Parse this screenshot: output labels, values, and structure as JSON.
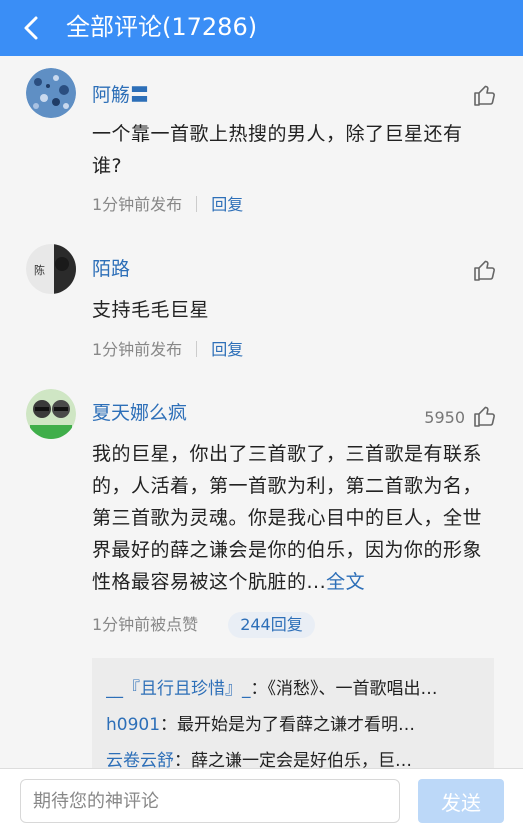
{
  "header": {
    "title": "全部评论(17286)",
    "back_icon": "chevron-left-icon",
    "background": "#3a8ef6"
  },
  "comments": [
    {
      "username": "阿觞〓",
      "text": "一个靠一首歌上热搜的男人，除了巨星还有谁?",
      "time": "1分钟前发布",
      "reply_label": "回复",
      "like_count": ""
    },
    {
      "username": "陌路",
      "text": "支持毛毛巨星",
      "time": "1分钟前发布",
      "reply_label": "回复",
      "like_count": ""
    },
    {
      "username": "夏天娜么疯",
      "text": "我的巨星，你出了三首歌了，三首歌是有联系的，人活着，第一首歌为利，第二首歌为名，第三首歌为灵魂。你是我心目中的巨人，全世界最好的薛之谦会是你的伯乐，因为你的形象性格最容易被这个肮脏的...",
      "full_text_label": "全文",
      "time": "1分钟前被点赞",
      "reply_label": "244回复",
      "like_count": "5950"
    }
  ],
  "sub_replies": [
    {
      "name": "__『且行且珍惜』_",
      "text": "：《消愁》、一首歌唱出…"
    },
    {
      "name": "h0901",
      "text": "：最开始是为了看薛之谦才看明…"
    },
    {
      "name": "云卷云舒",
      "text": "：薛之谦一定会是好伯乐，巨…"
    }
  ],
  "composer": {
    "placeholder": "期待您的神评论",
    "send_label": "发送"
  }
}
